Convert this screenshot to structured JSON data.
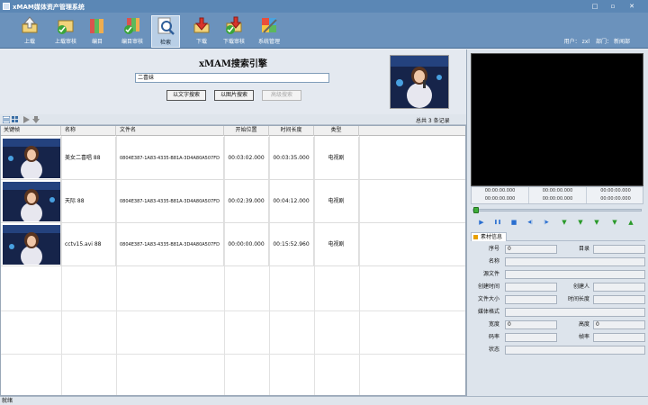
{
  "window": {
    "title": "xMAM媒体资产管理系统",
    "controls": [
      "□",
      "▫",
      "✕"
    ]
  },
  "toolbar": {
    "buttons": [
      {
        "label": "上载",
        "icon": "upload-icon"
      },
      {
        "label": "上载审核",
        "icon": "upload-review-icon"
      },
      {
        "label": "编目",
        "icon": "catalog-icon"
      },
      {
        "label": "编目审核",
        "icon": "catalog-review-icon"
      },
      {
        "label": "检索",
        "icon": "search-icon"
      },
      {
        "label": "下载",
        "icon": "download-icon"
      },
      {
        "label": "下载审核",
        "icon": "download-review-icon"
      },
      {
        "label": "系统管理",
        "icon": "system-manage-icon"
      }
    ],
    "active": "检索"
  },
  "user": {
    "user_label": "用户：",
    "user_value": "zxl",
    "dept_label": "部门：",
    "dept_value": "新闻部"
  },
  "search": {
    "engine_title": "xMAM搜索引擎",
    "query": "二喜妹",
    "text_search_btn": "以文字搜索",
    "image_search_btn": "以图片搜索",
    "advanced_btn": "高级搜索"
  },
  "list_toolbar": {
    "record_count": "总共 3 条记录"
  },
  "grid": {
    "headers": [
      "关键帧",
      "名称",
      "文件名",
      "开始位置",
      "时间长度",
      "类型"
    ],
    "rows": [
      {
        "name": "美女二喜唱 88",
        "file": "0804E387-1A83-4335-B81A-3D4A80A507FD",
        "start": "00:03:02.000",
        "duration": "00:03:35.000",
        "type": "电视剧"
      },
      {
        "name": "天际 88",
        "file": "0804E387-1A83-4335-B81A-3D4A80A507FD",
        "start": "00:02:39.000",
        "duration": "00:04:12.000",
        "type": "电视剧"
      },
      {
        "name": "cctv15.avi 88",
        "file": "0804E387-1A83-4335-B81A-3D4A80A507FD",
        "start": "00:00:00.000",
        "duration": "00:15:52.960",
        "type": "电视剧"
      }
    ]
  },
  "status": {
    "text": "就绪"
  },
  "player": {
    "timecodes": [
      "00:00:00.000",
      "00:00:00.000",
      "00:00:00.000",
      "00:00:00.000",
      "00:00:00.000",
      "00:00:00.000"
    ],
    "progress": 0,
    "controls": [
      {
        "icon": "play-icon",
        "glyph": "▶"
      },
      {
        "icon": "pause-icon",
        "glyph": "❚❚"
      },
      {
        "icon": "stop-icon",
        "glyph": "■"
      },
      {
        "icon": "prev-frame-icon",
        "glyph": "◀|"
      },
      {
        "icon": "next-frame-icon",
        "glyph": "|▶"
      },
      {
        "icon": "mark-in-icon",
        "glyph": "▼"
      },
      {
        "icon": "mark-out-icon",
        "glyph": "▼"
      },
      {
        "icon": "goto-in-icon",
        "glyph": "▼"
      },
      {
        "icon": "goto-out-icon",
        "glyph": "▼"
      },
      {
        "icon": "export-clip-icon",
        "glyph": "▲"
      }
    ]
  },
  "material_info": {
    "tab_label": "素材信息",
    "serial_label": "序号",
    "serial_value": "0",
    "catalog_label": "目录",
    "catalog_value": "",
    "name_label": "名称",
    "name_value": "",
    "source_label": "源文件",
    "source_value": "",
    "created_time_label": "创建时间",
    "created_time_value": "",
    "creator_label": "创建人",
    "creator_value": "",
    "file_size_label": "文件大小",
    "file_size_value": "",
    "duration_label": "时间长度",
    "duration_value": "",
    "media_format_label": "媒体格式",
    "media_format_value": "",
    "width_label": "宽度",
    "width_value": "0",
    "height_label": "高度",
    "height_value": "0",
    "bitrate_label": "码率",
    "bitrate_value": "",
    "framerate_label": "帧率",
    "framerate_value": "",
    "status_label": "状态",
    "status_value": ""
  }
}
